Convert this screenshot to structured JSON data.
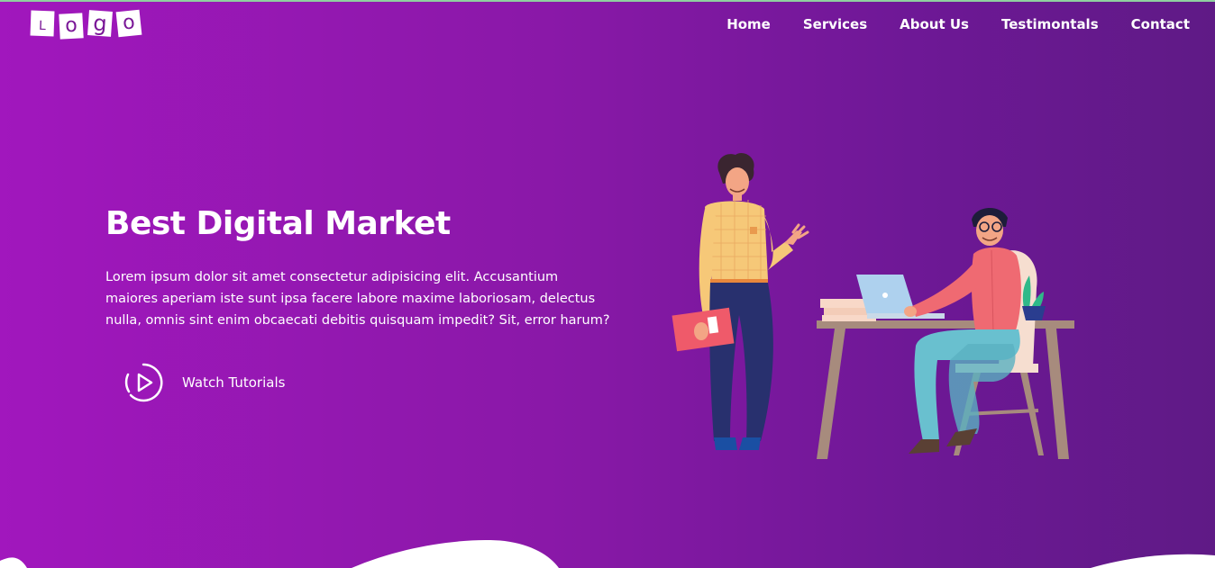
{
  "logo": {
    "letters": [
      "L",
      "o",
      "g",
      "o"
    ]
  },
  "nav": {
    "items": [
      "Home",
      "Services",
      "About Us",
      "Testimontals",
      "Contact"
    ]
  },
  "hero": {
    "title": "Best Digital Market",
    "description": "Lorem ipsum dolor sit amet consectetur adipisicing elit. Accusantium maiores aperiam iste sunt ipsa facere labore maxime laboriosam, delectus nulla, omnis sint enim obcaecati debitis quisquam impedit? Sit, error harum?",
    "watch_label": "Watch Tutorials"
  },
  "colors": {
    "gradient_start": "#a117bd",
    "gradient_end": "#5f1a86",
    "text": "#ffffff"
  },
  "icons": {
    "play": "play-circle-icon"
  }
}
